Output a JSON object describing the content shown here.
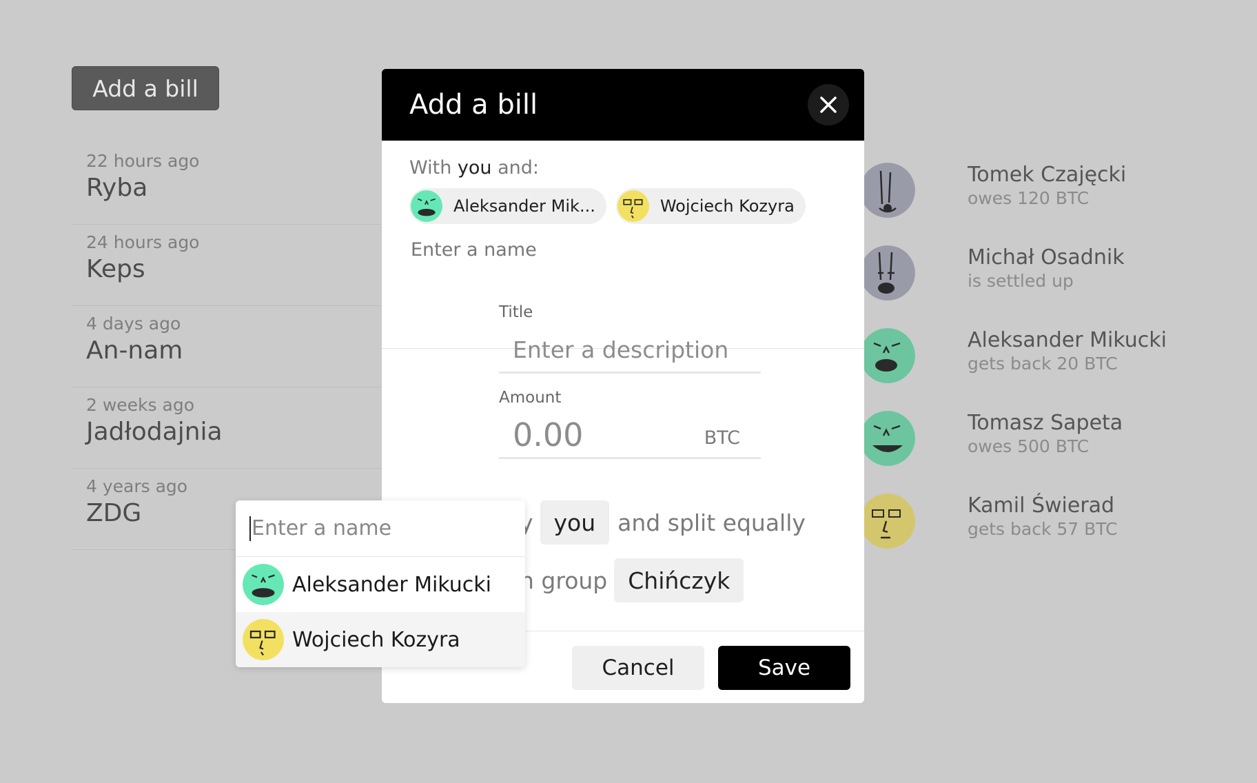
{
  "toolbar": {
    "add_bill_label": "Add a bill"
  },
  "bills": [
    {
      "time": "22 hours ago",
      "title": "Ryba"
    },
    {
      "time": "24 hours ago",
      "title": "Keps"
    },
    {
      "time": "4 days ago",
      "title": "An-nam"
    },
    {
      "time": "2 weeks ago",
      "title": "Jadłodajnia"
    },
    {
      "time": "4 years ago",
      "title": "ZDG"
    }
  ],
  "people": [
    {
      "name": "Tomek Czajęcki",
      "status": "owes 120 BTC",
      "avatar_color": "#9a9ba8"
    },
    {
      "name": "Michał Osadnik",
      "status": "is settled up",
      "avatar_color": "#9a9ba8"
    },
    {
      "name": "Aleksander Mikucki",
      "status": "gets back 20 BTC",
      "avatar_color": "#6cc59f"
    },
    {
      "name": "Tomasz Sapeta",
      "status": "owes 500 BTC",
      "avatar_color": "#6cc59f"
    },
    {
      "name": "Kamil Świerad",
      "status": "gets back 57 BTC",
      "avatar_color": "#d4c66c"
    }
  ],
  "modal": {
    "title": "Add a bill",
    "close_icon": "close-icon",
    "with_prefix": "With",
    "with_you": "you",
    "with_suffix": "and:",
    "chips": [
      {
        "name": "Aleksander Mik...",
        "avatar_color": "#66e8b6"
      },
      {
        "name": "Wojciech Kozyra",
        "avatar_color": "#f3e060"
      }
    ],
    "name_placeholder": "Enter a name",
    "title_label": "Title",
    "title_placeholder": "Enter a description",
    "amount_label": "Amount",
    "amount_value": "0.00",
    "currency": "BTC",
    "paid_by_prefix": "y",
    "paid_by_value": "you",
    "split_text": "and split equally",
    "group_prefix": "n group",
    "group_value": "Chińczyk",
    "cancel_label": "Cancel",
    "save_label": "Save"
  },
  "dropdown": {
    "placeholder": "Enter a name",
    "items": [
      {
        "name": "Aleksander Mikucki",
        "avatar_color": "#66e8b6"
      },
      {
        "name": "Wojciech Kozyra",
        "avatar_color": "#f3e060"
      }
    ]
  }
}
